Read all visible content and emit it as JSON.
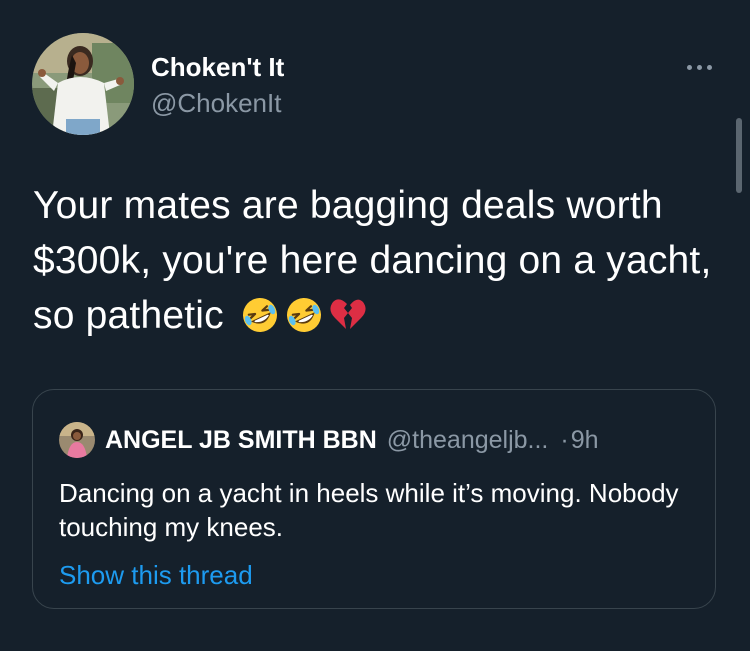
{
  "tweet": {
    "author": {
      "display_name": "Choken't It",
      "handle": "@ChokenIt"
    },
    "text": "Your mates are bagging deals worth $300k, you're here dancing on a yacht, so pathetic",
    "emojis": [
      "rolling-on-floor-laughing-emoji",
      "rolling-on-floor-laughing-emoji",
      "broken-heart-emoji"
    ]
  },
  "quoted_tweet": {
    "author": {
      "display_name": "ANGEL JB SMITH BBN",
      "handle": "@theangeljb..."
    },
    "separator": "·",
    "time": "9h",
    "text": "Dancing on a yacht in heels while it’s moving. Nobody touching my knees.",
    "show_thread_label": "Show this thread"
  },
  "colors": {
    "background": "#15202b",
    "primary_text": "#ffffff",
    "secondary_text": "#8b98a5",
    "link": "#1d9bf0",
    "border": "#38444d"
  },
  "icons": {
    "more": "more-horizontal-icon"
  }
}
